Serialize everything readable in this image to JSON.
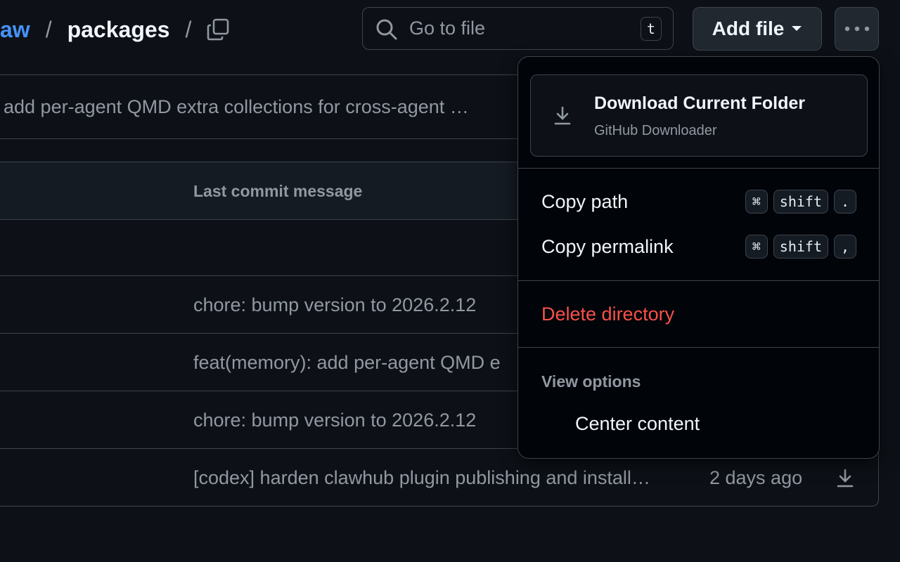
{
  "breadcrumb": {
    "repo": "aw",
    "separator": "/",
    "current": "packages",
    "trailing_separator": "/"
  },
  "search": {
    "placeholder": "Go to file",
    "shortcut": "t"
  },
  "toolbar": {
    "add_file_label": "Add file"
  },
  "latest_commit": {
    "message": "add per-agent QMD extra collections for cross-agent …"
  },
  "table": {
    "column_header": "Last commit message",
    "rows": [
      {
        "message": "",
        "date": ""
      },
      {
        "message": "chore: bump version to 2026.2.12",
        "date": ""
      },
      {
        "message": "feat(memory): add per-agent QMD e",
        "date": ""
      },
      {
        "message": "chore: bump version to 2026.2.12",
        "date": ""
      },
      {
        "message": "[codex] harden clawhub plugin publishing and install…",
        "date": "2 days ago"
      }
    ]
  },
  "menu": {
    "download": {
      "title": "Download Current Folder",
      "subtitle": "GitHub Downloader"
    },
    "copy_path": {
      "label": "Copy path",
      "keys": [
        "⌘",
        "shift",
        "."
      ]
    },
    "copy_permalink": {
      "label": "Copy permalink",
      "keys": [
        "⌘",
        "shift",
        ","
      ]
    },
    "delete_label": "Delete directory",
    "view_options_label": "View options",
    "center_content_label": "Center content"
  },
  "colors": {
    "background": "#0d1117",
    "accent": "#4493f8",
    "danger": "#f85149",
    "border": "#3d444d"
  }
}
